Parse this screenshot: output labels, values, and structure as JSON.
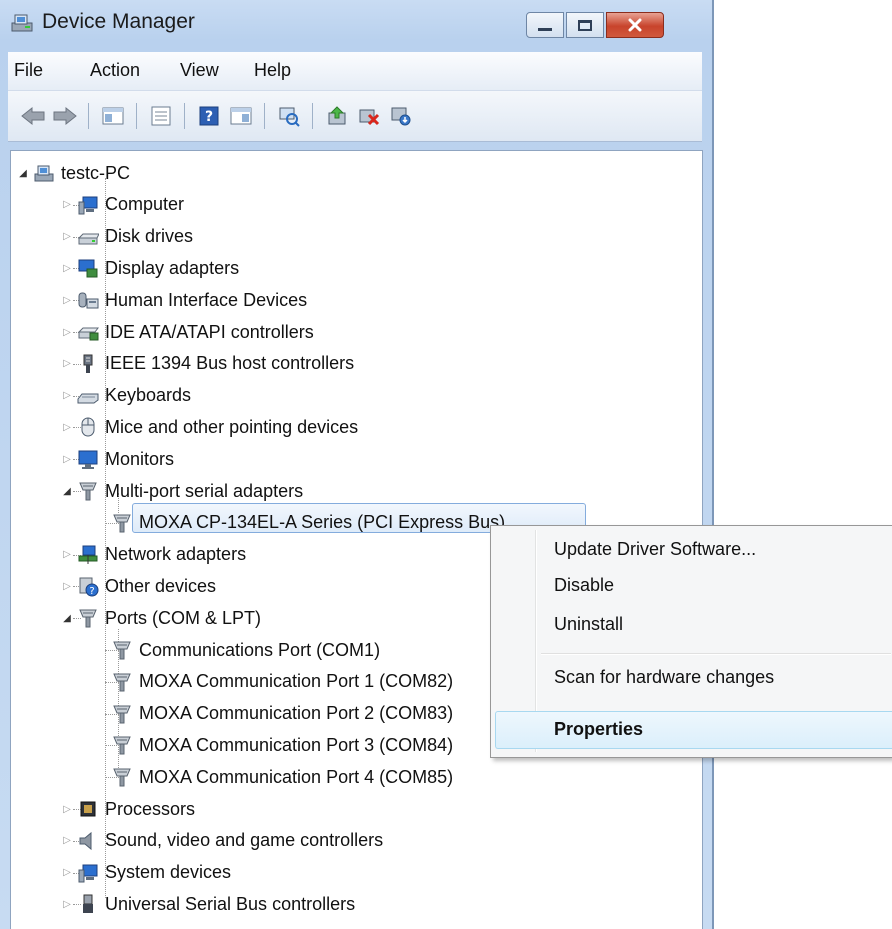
{
  "window": {
    "title": "Device Manager"
  },
  "menu": [
    "File",
    "Action",
    "View",
    "Help"
  ],
  "toolbar": {
    "buttons": [
      "back-icon",
      "forward-icon",
      "show-hide-tree-icon",
      "properties-icon",
      "help-icon",
      "action-pane-icon",
      "scan-hardware-icon",
      "update-driver-icon",
      "uninstall-icon",
      "disable-icon"
    ]
  },
  "tree": {
    "root": "testc-PC",
    "categories": [
      {
        "label": "Computer",
        "icon": "computer-icon"
      },
      {
        "label": "Disk drives",
        "icon": "disk-drive-icon"
      },
      {
        "label": "Display adapters",
        "icon": "display-adapter-icon"
      },
      {
        "label": "Human Interface Devices",
        "icon": "hid-icon"
      },
      {
        "label": "IDE ATA/ATAPI controllers",
        "icon": "ide-controller-icon"
      },
      {
        "label": "IEEE 1394 Bus host controllers",
        "icon": "ieee1394-icon"
      },
      {
        "label": "Keyboards",
        "icon": "keyboard-icon"
      },
      {
        "label": "Mice and other pointing devices",
        "icon": "mouse-icon"
      },
      {
        "label": "Monitors",
        "icon": "monitor-icon"
      },
      {
        "label": "Multi-port serial adapters",
        "icon": "serial-adapter-icon"
      },
      {
        "label": "MOXA CP-134EL-A Series (PCI Express Bus)",
        "icon": "serial-adapter-icon"
      },
      {
        "label": "Network adapters",
        "icon": "network-adapter-icon"
      },
      {
        "label": "Other devices",
        "icon": "unknown-device-icon"
      },
      {
        "label": "Ports (COM & LPT)",
        "icon": "port-icon"
      },
      {
        "label": "Communications Port (COM1)",
        "icon": "port-icon"
      },
      {
        "label": "MOXA Communication Port 1 (COM82)",
        "icon": "port-icon"
      },
      {
        "label": "MOXA Communication Port 2 (COM83)",
        "icon": "port-icon"
      },
      {
        "label": "MOXA Communication Port 3 (COM84)",
        "icon": "port-icon"
      },
      {
        "label": "MOXA Communication Port 4 (COM85)",
        "icon": "port-icon"
      },
      {
        "label": "Processors",
        "icon": "processor-icon"
      },
      {
        "label": "Sound, video and game controllers",
        "icon": "sound-icon"
      },
      {
        "label": "System devices",
        "icon": "system-device-icon"
      },
      {
        "label": "Universal Serial Bus controllers",
        "icon": "usb-icon"
      }
    ]
  },
  "context_menu": {
    "items": [
      "Update Driver Software...",
      "Disable",
      "Uninstall",
      "Scan for hardware changes",
      "Properties"
    ],
    "highlighted": "Properties"
  },
  "colors": {
    "selection_border": "#84acdd",
    "close_button": "#c8442c",
    "menu_hover": "#dbeffb"
  }
}
